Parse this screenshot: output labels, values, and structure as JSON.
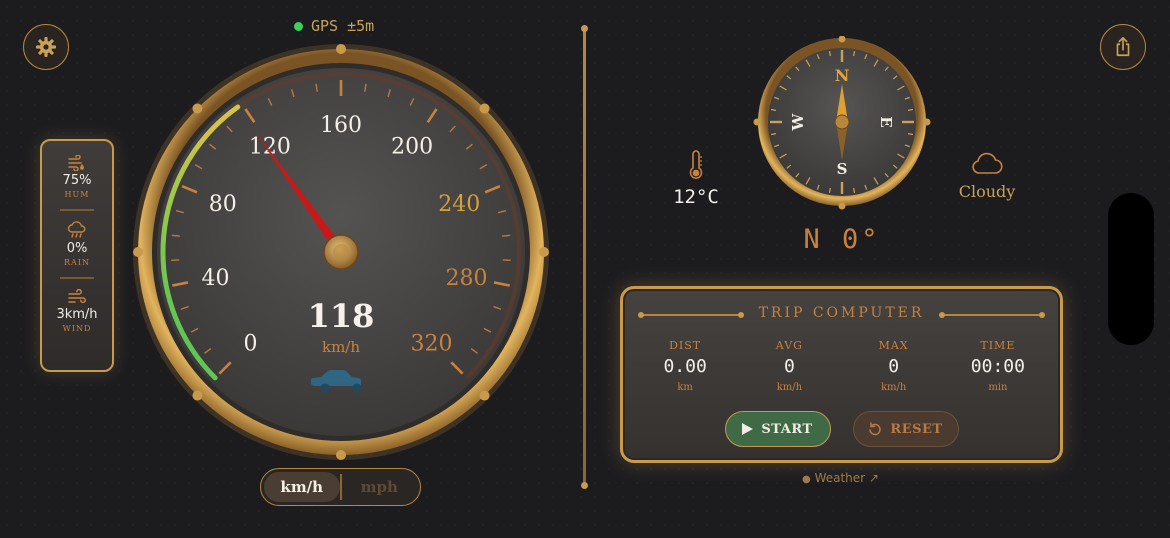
{
  "gps": {
    "label": "GPS ±5m",
    "color": "#3ecf5a"
  },
  "weather_panel": {
    "humidity": {
      "value": "75%",
      "label": "HUM",
      "icon": "humidity-icon"
    },
    "rain": {
      "value": "0%",
      "label": "RAIN",
      "icon": "rain-cloud-icon"
    },
    "wind": {
      "value": "3km/h",
      "label": "WIND",
      "icon": "wind-icon"
    }
  },
  "speedometer": {
    "ticks": [
      "0",
      "40",
      "80",
      "120",
      "160",
      "200",
      "240",
      "280",
      "320"
    ],
    "max": 320,
    "speed": "118",
    "speed_value": 118,
    "unit": "km/h"
  },
  "unit_toggle": {
    "selected": "km/h",
    "other": "mph"
  },
  "compass": {
    "n": "N",
    "e": "E",
    "s": "S",
    "w": "W",
    "heading": "N 0°"
  },
  "temperature": {
    "value": "12°C"
  },
  "condition": {
    "value": "Cloudy"
  },
  "trip": {
    "title": "TRIP COMPUTER",
    "stats": [
      {
        "label": "DIST",
        "value": "0.00",
        "unit": "km"
      },
      {
        "label": "AVG",
        "value": "0",
        "unit": "km/h"
      },
      {
        "label": "MAX",
        "value": "0",
        "unit": "km/h"
      },
      {
        "label": "TIME",
        "value": "00:00",
        "unit": "min"
      }
    ],
    "start_label": "START",
    "reset_label": "RESET"
  },
  "credit": "Weather ↗",
  "colors": {
    "gold": "#c99a4e",
    "accent": "#c9823e",
    "needle": "#d11a1a",
    "start": "#3f6a45"
  }
}
